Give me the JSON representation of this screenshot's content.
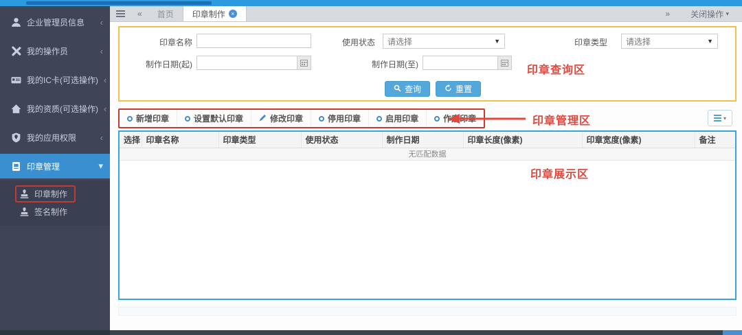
{
  "tabbar": {
    "home_label": "首页",
    "active_label": "印章制作",
    "close_ops_label": "关闭操作"
  },
  "sidebar": {
    "items": [
      {
        "label": "企业管理员信息",
        "icon": "user-icon"
      },
      {
        "label": "我的操作员",
        "icon": "tools-icon"
      },
      {
        "label": "我的IC卡(可选操作)",
        "icon": "id-card-icon"
      },
      {
        "label": "我的资质(可选操作)",
        "icon": "home-icon"
      },
      {
        "label": "我的应用权限",
        "icon": "shield-icon"
      },
      {
        "label": "印章管理",
        "icon": "seal-book-icon",
        "active": true
      }
    ],
    "subitems": [
      {
        "label": "印章制作",
        "icon": "stamp-icon",
        "highlighted": true
      },
      {
        "label": "签名制作",
        "icon": "stamp-icon",
        "highlighted": false
      }
    ]
  },
  "search": {
    "name_label": "印章名称",
    "status_label": "使用状态",
    "type_label": "印章类型",
    "date_from_label": "制作日期(起)",
    "date_to_label": "制作日期(至)",
    "select_value": "请选择",
    "query_label": "查询",
    "reset_label": "重置",
    "annotation": "印章查询区"
  },
  "toolbar": {
    "items": [
      {
        "label": "新增印章",
        "icon": "ring"
      },
      {
        "label": "设置默认印章",
        "icon": "ring"
      },
      {
        "label": "修改印章",
        "icon": "pencil"
      },
      {
        "label": "停用印章",
        "icon": "ring"
      },
      {
        "label": "启用印章",
        "icon": "ring"
      },
      {
        "label": "作废印章",
        "icon": "ring"
      }
    ],
    "annotation": "印章管理区"
  },
  "table": {
    "headers": [
      "选择",
      "印章名称",
      "印章类型",
      "使用状态",
      "制作日期",
      "印章长度(像素)",
      "印章宽度(像素)",
      "备注"
    ],
    "empty_text": "无匹配数据",
    "annotation": "印章展示区"
  },
  "colors": {
    "accent_blue": "#3a8fd0",
    "annotation_red": "#e0493f",
    "panel_border_yellow": "#f0c14b",
    "table_border_blue": "#36a5d8",
    "sidebar_bg": "#3f4557",
    "button_blue": "#54a7da"
  }
}
